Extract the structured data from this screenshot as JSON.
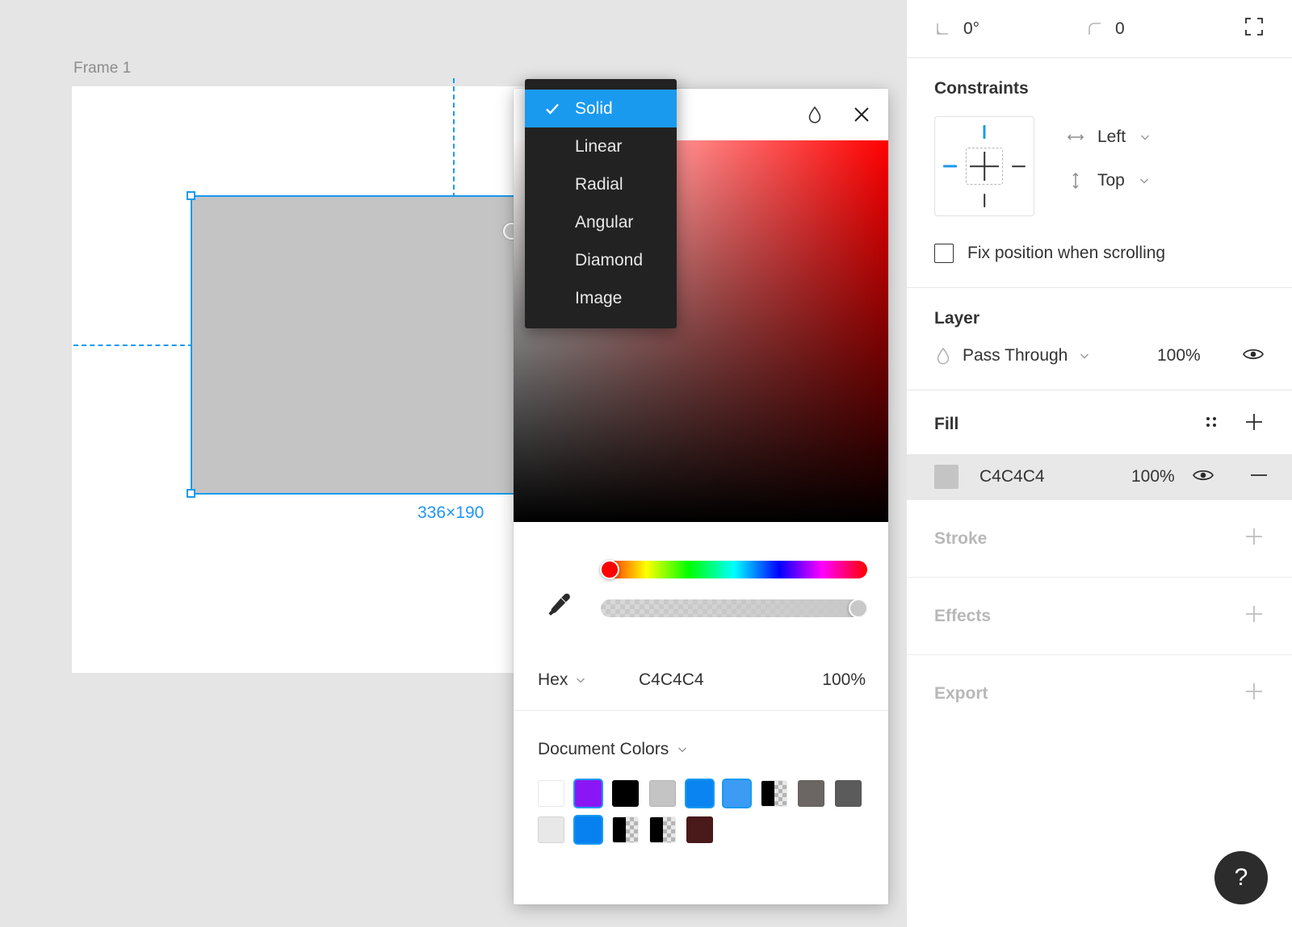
{
  "canvas": {
    "frame_label": "Frame 1",
    "dimension_label": "336×190",
    "selection_color": "#C4C4C4",
    "accent": "#1A9AEF"
  },
  "fill_type_menu": {
    "items": [
      {
        "label": "Solid",
        "selected": true
      },
      {
        "label": "Linear",
        "selected": false
      },
      {
        "label": "Radial",
        "selected": false
      },
      {
        "label": "Angular",
        "selected": false
      },
      {
        "label": "Diamond",
        "selected": false
      },
      {
        "label": "Image",
        "selected": false
      }
    ]
  },
  "color_picker": {
    "blend_icon": "droplet-icon",
    "close_icon": "close-icon",
    "eyedropper_icon": "eyedropper-icon",
    "hue_value_color": "#FF0000",
    "mode_label": "Hex",
    "hex_value": "C4C4C4",
    "alpha_value": "100%",
    "document_colors_label": "Document Colors",
    "swatches": [
      {
        "name": "white",
        "color": "#FFFFFF",
        "type": "solid",
        "selected": false
      },
      {
        "name": "purple",
        "color": "#8B16F5",
        "type": "solid",
        "selected": true
      },
      {
        "name": "black",
        "color": "#000000",
        "type": "solid",
        "selected": false
      },
      {
        "name": "light-gray",
        "color": "#C4C4C4",
        "type": "solid",
        "selected": false
      },
      {
        "name": "blue",
        "color": "#0A84F0",
        "type": "solid",
        "selected": true
      },
      {
        "name": "sky-blue",
        "color": "#3B9BF5",
        "type": "solid",
        "selected": true
      },
      {
        "name": "black-alpha",
        "color": "#000000",
        "type": "alpha",
        "selected": false
      },
      {
        "name": "gray-warm",
        "color": "#6B6663",
        "type": "solid",
        "selected": false
      },
      {
        "name": "gray-dark",
        "color": "#5B5B5B",
        "type": "solid",
        "selected": false
      },
      {
        "name": "off-white",
        "color": "#E8E8E8",
        "type": "solid",
        "selected": false
      },
      {
        "name": "blue-bright",
        "color": "#0781EF",
        "type": "solid",
        "selected": true
      },
      {
        "name": "black-alpha-2",
        "color": "#000000",
        "type": "alpha",
        "selected": false
      },
      {
        "name": "black-alpha-3",
        "color": "#000000",
        "type": "alpha",
        "selected": false
      },
      {
        "name": "dark-maroon",
        "color": "#4A1A1A",
        "type": "solid",
        "selected": false
      }
    ]
  },
  "right_panel": {
    "top_row": {
      "rotation_label": "0°",
      "rotation_icon": "angle-icon",
      "corner_radius_label": "0",
      "corner_radius_icon": "corner-radius-icon",
      "independent_corners_icon": "independent-corners-icon"
    },
    "constraints": {
      "title": "Constraints",
      "horizontal_icon": "horizontal-arrows-icon",
      "horizontal_value": "Left",
      "vertical_icon": "vertical-arrows-icon",
      "vertical_value": "Top",
      "fix_position_label": "Fix position when scrolling",
      "fix_position_checked": false
    },
    "layer": {
      "title": "Layer",
      "blend_icon": "droplet-icon",
      "blend_mode": "Pass Through",
      "opacity": "100%",
      "visibility_icon": "eye-icon"
    },
    "fill": {
      "title": "Fill",
      "styles_icon": "styles-grid-icon",
      "add_icon": "plus-icon",
      "items": [
        {
          "swatch_color": "#C4C4C4",
          "hex": "C4C4C4",
          "opacity": "100%",
          "visibility_icon": "eye-icon",
          "remove_icon": "minus-icon"
        }
      ]
    },
    "empty_sections": [
      {
        "title": "Stroke",
        "add_icon": "plus-icon"
      },
      {
        "title": "Effects",
        "add_icon": "plus-icon"
      },
      {
        "title": "Export",
        "add_icon": "plus-icon"
      }
    ]
  },
  "help": {
    "label": "?",
    "icon": "help-icon"
  }
}
